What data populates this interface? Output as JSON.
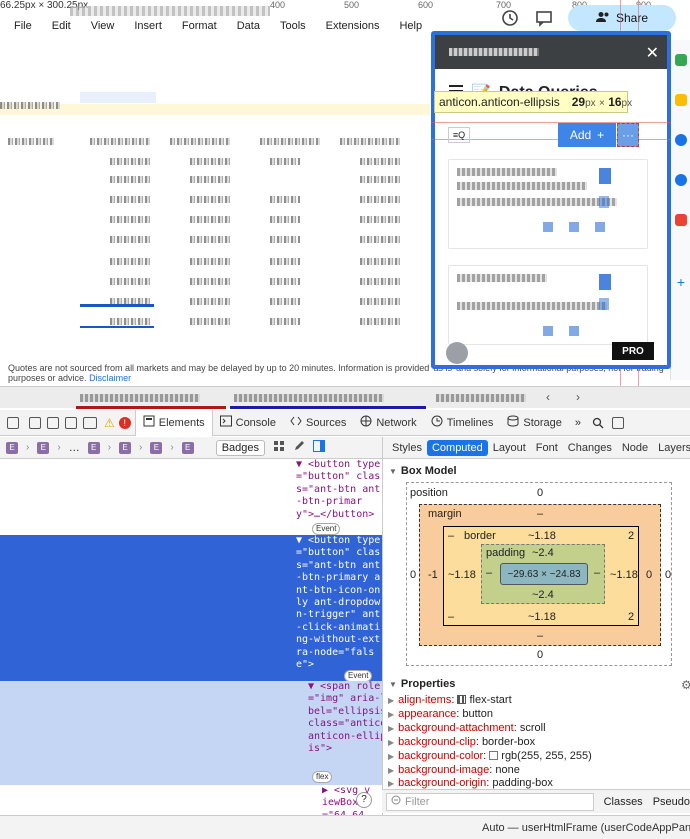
{
  "ruler_readout": "66.25px × 300.25px",
  "ruler_ticks": [
    "400",
    "500",
    "600",
    "700",
    "800",
    "900"
  ],
  "menu": [
    "File",
    "Edit",
    "View",
    "Insert",
    "Format",
    "Data",
    "Tools",
    "Extensions",
    "Help"
  ],
  "share_label": "Share",
  "disclaimer_text": "Quotes are not sourced from all markets and may be delayed by up to 20 minutes. Information is provided 'as is' and solely for informational purposes, not for trading purposes or advice.",
  "disclaimer_link": "Disclaimer",
  "addon": {
    "title": "Data Queries",
    "title_emoji": "📝",
    "close_glyph": "✕",
    "add_label": "Add",
    "add_glyph": "+",
    "ellipsis_glyph": "···",
    "pro_label": "PRO",
    "search_glyph": "≡Q"
  },
  "tooltip": {
    "selector": "anticon.anticon-ellipsis",
    "w": "29",
    "h": "16",
    "unit": "px",
    "times": "×"
  },
  "devtools": {
    "tools": [
      "Elements",
      "Console",
      "Sources",
      "Network",
      "Timelines",
      "Storage"
    ],
    "more_glyph": "»",
    "badges_label": "Badges",
    "crumb_letter": "E",
    "crumb_ellipsis": "…",
    "right_tabs": [
      "Styles",
      "Computed",
      "Layout",
      "Font",
      "Changes",
      "Node",
      "Layers"
    ],
    "active_right_tab": "Computed"
  },
  "dom": {
    "line1": "▼ <button type=\"button\" class=\"ant-btn ant-btn-primary\">…</button>",
    "event1": "Event",
    "line2": "▼ <button type=\"button\" class=\"ant-btn ant-btn-primary ant-btn-icon-only ant-dropdown-trigger\" ant-click-animating-without-extra-node=\"false\">",
    "event2": "Event",
    "line3": "▼ <span role=\"img\" aria-label=\"ellipsis\" class=\"anticon anticon-ellipsis\">",
    "flex_badge": "flex",
    "line4": "▶ <svg viewBox=\"64 64",
    "help": "?"
  },
  "box_model": {
    "section": "Box Model",
    "position_label": "position",
    "position_top": "0",
    "position_bottom": "0",
    "position_left": "0",
    "position_right": "0",
    "margin_label": "margin",
    "margin_top": "–",
    "margin_bottom": "–",
    "margin_left": "-1",
    "margin_right": "0",
    "border_label": "border",
    "border_top": "~1.18",
    "border_bottom": "~1.18",
    "border_left": "~1.18",
    "border_right": "~1.18",
    "border_tl": "–",
    "border_tr": "2",
    "border_bl": "–",
    "border_br": "2",
    "padding_label": "padding",
    "padding_top": "~2.4",
    "padding_bottom": "~2.4",
    "padding_left": "–",
    "padding_right": "–",
    "content": "~29.63 × ~24.83"
  },
  "properties": {
    "section": "Properties",
    "items": [
      {
        "name": "align-items",
        "value": "flex-start"
      },
      {
        "name": "appearance",
        "value": "button"
      },
      {
        "name": "background-attachment",
        "value": "scroll"
      },
      {
        "name": "background-clip",
        "value": "border-box"
      },
      {
        "name": "background-color",
        "value": "rgb(255, 255, 255)"
      },
      {
        "name": "background-image",
        "value": "none"
      },
      {
        "name": "background-origin",
        "value": "padding-box"
      }
    ]
  },
  "filter": {
    "placeholder": "Filter",
    "classes": "Classes",
    "pseudo": "Pseudo"
  },
  "status": "Auto — userHtmlFrame (userCodeAppPanel)",
  "colors": {
    "accent": "#2d6fdc",
    "add_button": "#3d86e8",
    "share_bg": "#c2e7ff",
    "selection": "#2f63d6"
  }
}
